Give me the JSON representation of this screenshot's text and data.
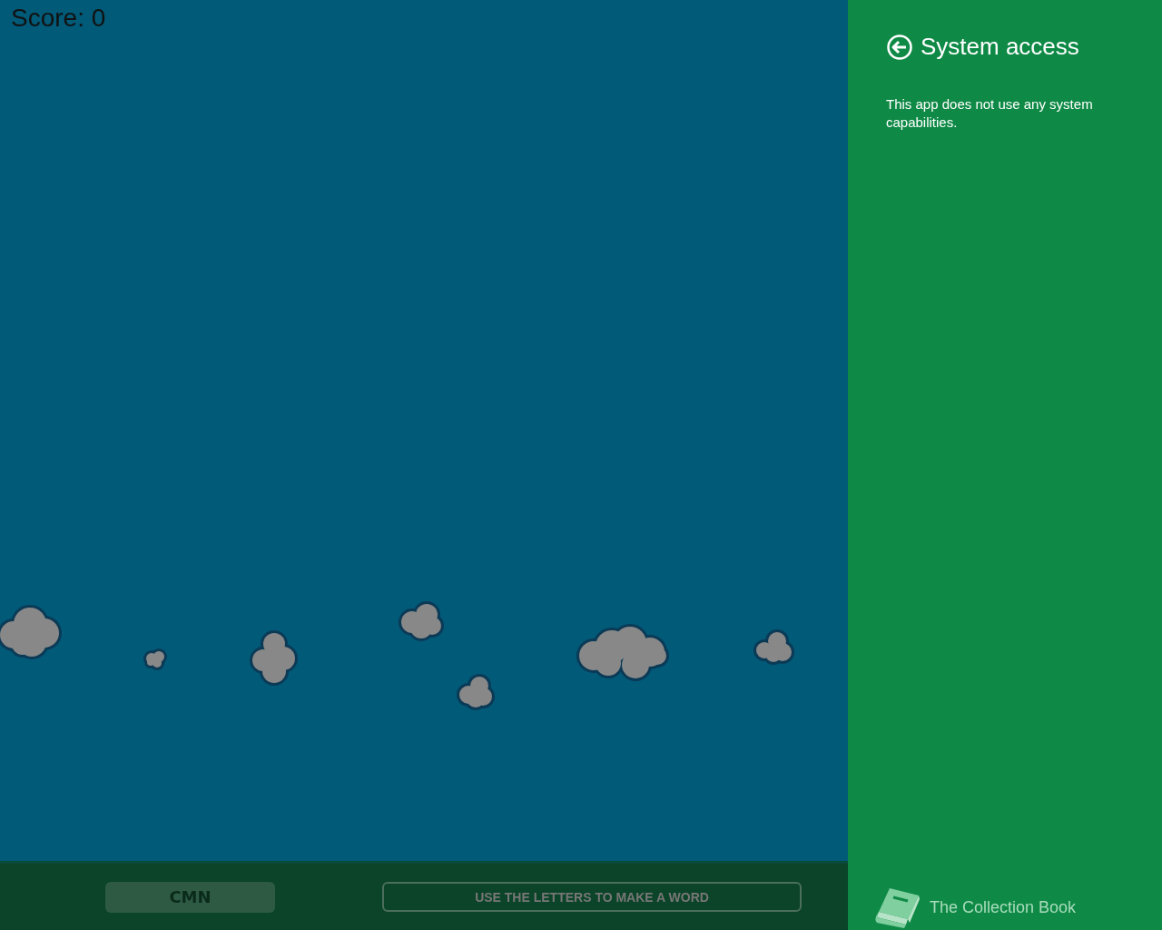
{
  "game": {
    "score": "Score: 0",
    "letters": "CMN",
    "hint": "USE THE LETTERS TO MAKE A WORD"
  },
  "panel": {
    "title": "System access",
    "message": "This app does not use any system capabilities.",
    "app_name": "The Collection Book"
  }
}
